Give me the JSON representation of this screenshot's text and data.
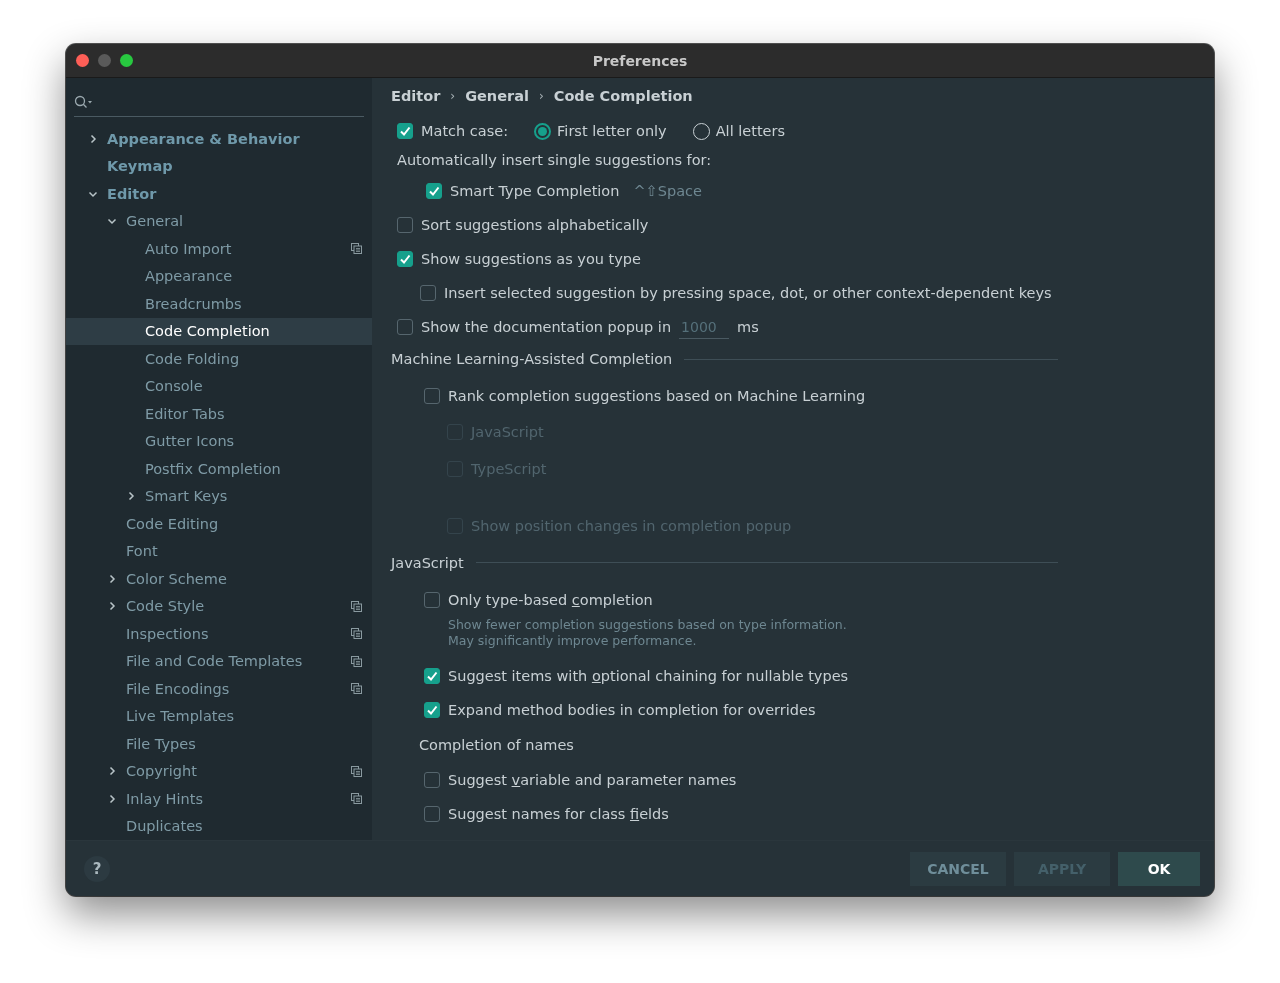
{
  "window": {
    "title": "Preferences"
  },
  "sidebar": {
    "items": [
      {
        "label": "Appearance & Behavior",
        "expanded": false,
        "selected": false,
        "project_icon": false
      },
      {
        "label": "Keymap",
        "selected": false,
        "project_icon": false
      },
      {
        "label": "Editor",
        "expanded": true,
        "selected": false,
        "project_icon": false,
        "children": [
          {
            "label": "General",
            "expanded": true,
            "selected": false,
            "project_icon": false,
            "children": [
              {
                "label": "Auto Import",
                "selected": false,
                "project_icon": true
              },
              {
                "label": "Appearance",
                "selected": false,
                "project_icon": false
              },
              {
                "label": "Breadcrumbs",
                "selected": false,
                "project_icon": false
              },
              {
                "label": "Code Completion",
                "selected": true,
                "project_icon": false
              },
              {
                "label": "Code Folding",
                "selected": false,
                "project_icon": false
              },
              {
                "label": "Console",
                "selected": false,
                "project_icon": false
              },
              {
                "label": "Editor Tabs",
                "selected": false,
                "project_icon": false
              },
              {
                "label": "Gutter Icons",
                "selected": false,
                "project_icon": false
              },
              {
                "label": "Postfix Completion",
                "selected": false,
                "project_icon": false
              },
              {
                "label": "Smart Keys",
                "expanded": false,
                "selected": false,
                "project_icon": false
              }
            ]
          },
          {
            "label": "Code Editing",
            "selected": false,
            "project_icon": false
          },
          {
            "label": "Font",
            "selected": false,
            "project_icon": false
          },
          {
            "label": "Color Scheme",
            "expanded": false,
            "selected": false,
            "project_icon": false
          },
          {
            "label": "Code Style",
            "expanded": false,
            "selected": false,
            "project_icon": true
          },
          {
            "label": "Inspections",
            "selected": false,
            "project_icon": true
          },
          {
            "label": "File and Code Templates",
            "selected": false,
            "project_icon": true
          },
          {
            "label": "File Encodings",
            "selected": false,
            "project_icon": true
          },
          {
            "label": "Live Templates",
            "selected": false,
            "project_icon": false
          },
          {
            "label": "File Types",
            "selected": false,
            "project_icon": false
          },
          {
            "label": "Copyright",
            "expanded": false,
            "selected": false,
            "project_icon": true
          },
          {
            "label": "Inlay Hints",
            "expanded": false,
            "selected": false,
            "project_icon": true
          },
          {
            "label": "Duplicates",
            "selected": false,
            "project_icon": false
          }
        ]
      }
    ]
  },
  "breadcrumbs": [
    {
      "label": "Editor"
    },
    {
      "separator": "›",
      "label": "General"
    },
    {
      "separator": "›",
      "label": "Code Completion"
    }
  ],
  "settings": [
    {
      "kind": "checkbox-radio",
      "label": "Match case:",
      "checked": true,
      "options": [
        {
          "label": "First letter only",
          "selected": true
        },
        {
          "label": "All letters",
          "selected": false
        }
      ]
    },
    {
      "kind": "heading",
      "label": "Automatically insert single suggestions for:",
      "children": [
        {
          "kind": "checkbox",
          "label": "Smart Type Completion",
          "checked": true,
          "shortcut": "^⇧Space"
        }
      ]
    },
    {
      "kind": "checkbox",
      "label": "Sort suggestions alphabetically",
      "checked": false
    },
    {
      "kind": "checkbox",
      "label": "Show suggestions as you type",
      "checked": true,
      "children": [
        {
          "kind": "checkbox",
          "label": "Insert selected suggestion by pressing space, dot, or other context-dependent keys",
          "checked": false
        }
      ]
    },
    {
      "kind": "checkbox-field",
      "label": "Show the documentation popup in",
      "checked": false,
      "value": "1000",
      "unit": "ms"
    },
    {
      "kind": "section",
      "label": "Machine Learning-Assisted Completion",
      "children": [
        {
          "kind": "checkbox",
          "label": "Rank completion suggestions based on Machine Learning",
          "checked": false,
          "disabled": false,
          "children": [
            {
              "kind": "checkbox",
              "label": "JavaScript",
              "checked": false,
              "disabled": true
            },
            {
              "kind": "checkbox",
              "label": "TypeScript",
              "checked": false,
              "disabled": true
            },
            {
              "kind": "checkbox",
              "label": "Show position changes in completion popup",
              "checked": false,
              "disabled": true
            }
          ]
        }
      ]
    },
    {
      "kind": "section",
      "label": "JavaScript",
      "children": [
        {
          "kind": "checkbox",
          "label_parts": [
            "Only type-based ",
            "c",
            "ompletion"
          ],
          "checked": false,
          "description": "Show fewer completion suggestions based on type information. May significantly improve performance."
        },
        {
          "kind": "checkbox",
          "label_parts": [
            "Suggest items with ",
            "o",
            "ptional chaining for nullable types"
          ],
          "checked": true
        },
        {
          "kind": "checkbox",
          "label": "Expand method bodies in completion for overrides",
          "checked": true
        },
        {
          "kind": "subheading",
          "label": "Completion of names",
          "children": [
            {
              "kind": "checkbox",
              "label_parts": [
                "Suggest ",
                "v",
                "ariable and parameter names"
              ],
              "checked": false
            },
            {
              "kind": "checkbox",
              "label_parts": [
                "Suggest names for class ",
                "f",
                "ields"
              ],
              "checked": false
            }
          ]
        }
      ]
    }
  ],
  "help_button": {
    "label": "?"
  },
  "buttons": [
    {
      "label": "CANCEL",
      "kind": "secondary",
      "disabled": false
    },
    {
      "label": "APPLY",
      "kind": "secondary",
      "disabled": true
    },
    {
      "label": "OK",
      "kind": "primary",
      "disabled": false
    }
  ]
}
